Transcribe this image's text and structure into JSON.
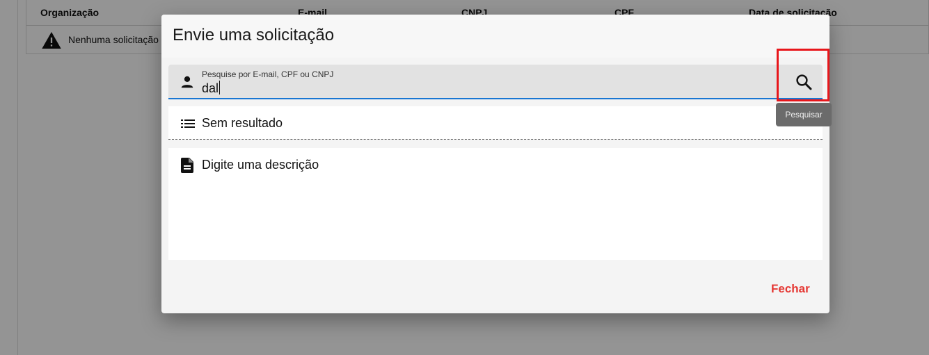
{
  "background": {
    "table_columns": [
      "Organização",
      "E-mail",
      "CNPJ",
      "CPF",
      "Data de solicitação"
    ],
    "empty_message": "Nenhuma solicitação",
    "empty_icon": "warning-icon"
  },
  "dialog": {
    "title": "Envie uma solicitação",
    "search": {
      "label": "Pesquise por E-mail, CPF ou CNPJ",
      "value": "dal",
      "leading_icon": "person-icon",
      "button_icon": "search-icon",
      "tooltip": "Pesquisar"
    },
    "result": {
      "icon": "list-icon",
      "text": "Sem resultado"
    },
    "description": {
      "icon": "document-icon",
      "placeholder": "Digite uma descrição"
    },
    "close_label": "Fechar"
  },
  "colors": {
    "accent_underline": "#1976d2",
    "close_red": "#e53935",
    "highlight_red": "#e8161b",
    "tooltip_bg": "#6b6b6b"
  }
}
